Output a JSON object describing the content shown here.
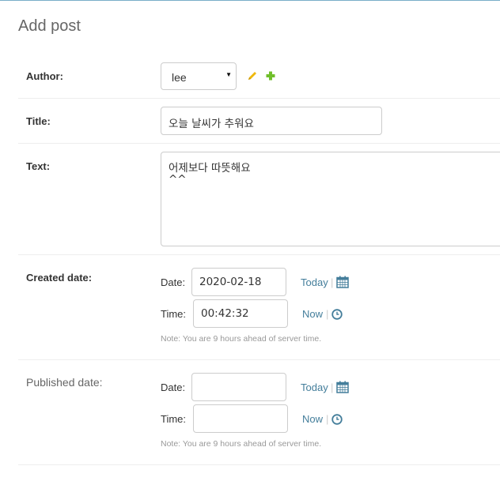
{
  "page": {
    "title": "Add post"
  },
  "fields": {
    "author": {
      "label": "Author:",
      "value": "lee",
      "caret": "▼"
    },
    "title": {
      "label": "Title:",
      "value": "오늘 날씨가 추워요"
    },
    "text": {
      "label": "Text:",
      "lines": [
        "어제보다 따뜻해요",
        "^^"
      ]
    },
    "created_date": {
      "label": "Created date:",
      "date_label": "Date:",
      "date_value": "2020-02-18",
      "today_label": "Today",
      "separator": "|",
      "time_label": "Time:",
      "time_value": "00:42:32",
      "now_label": "Now",
      "note": "Note: You are 9 hours ahead of server time."
    },
    "published_date": {
      "label": "Published date:",
      "date_label": "Date:",
      "date_value": "",
      "today_label": "Today",
      "separator": "|",
      "time_label": "Time:",
      "time_value": "",
      "now_label": "Now",
      "note": "Note: You are 9 hours ahead of server time."
    }
  },
  "icons": {
    "edit": "pencil-icon",
    "add": "plus-icon",
    "calendar": "calendar-icon",
    "clock": "clock-icon"
  },
  "colors": {
    "link": "#447e9b",
    "pencil": "#efb80b",
    "plus": "#70bf2b",
    "border": "#cccccc",
    "note": "#999999"
  }
}
